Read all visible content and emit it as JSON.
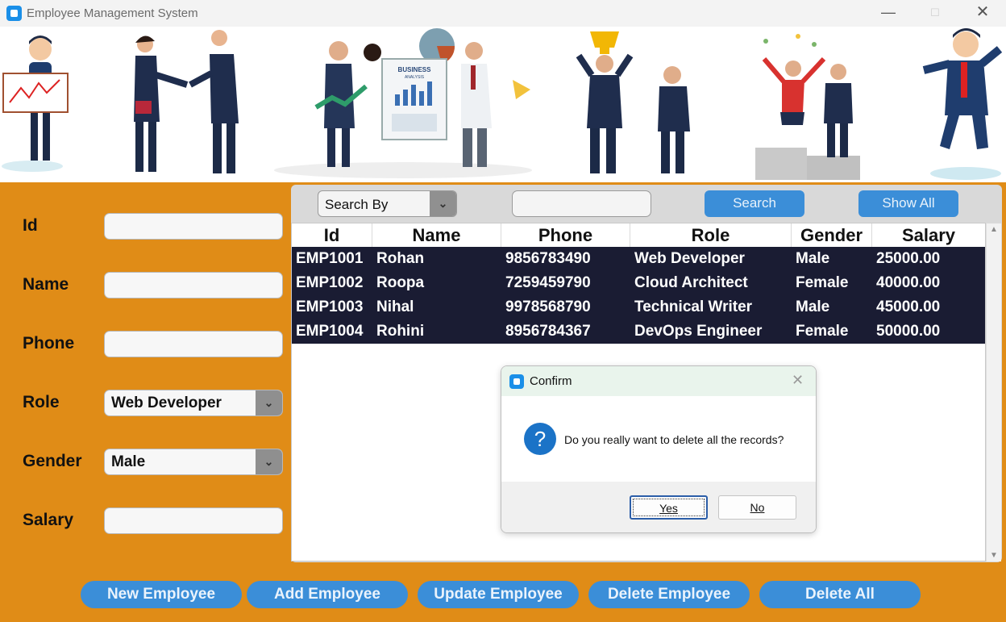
{
  "window": {
    "title": "Employee Management System",
    "controls": {
      "minimize": "—",
      "maximize": "☐",
      "close": "✕"
    }
  },
  "banner": {
    "chart_label_line1": "BUSINESS",
    "chart_label_line2": "ANALYSIS"
  },
  "form": {
    "id_label": "Id",
    "name_label": "Name",
    "phone_label": "Phone",
    "role_label": "Role",
    "role_value": "Web Developer",
    "gender_label": "Gender",
    "gender_value": "Male",
    "salary_label": "Salary"
  },
  "search": {
    "search_by": "Search By",
    "search_button": "Search",
    "show_all_button": "Show All"
  },
  "table": {
    "headers": [
      "Id",
      "Name",
      "Phone",
      "Role",
      "Gender",
      "Salary"
    ],
    "rows": [
      [
        "EMP1001",
        "Rohan",
        "9856783490",
        "Web Developer",
        "Male",
        "25000.00"
      ],
      [
        "EMP1002",
        "Roopa",
        "7259459790",
        "Cloud Architect",
        "Female",
        "40000.00"
      ],
      [
        "EMP1003",
        "Nihal",
        "9978568790",
        "Technical Writer",
        "Male",
        "45000.00"
      ],
      [
        "EMP1004",
        "Rohini",
        "8956784367",
        "DevOps Engineer",
        "Female",
        "50000.00"
      ]
    ]
  },
  "dialog": {
    "title": "Confirm",
    "message": "Do you really want to delete all the records?",
    "yes": "Yes",
    "no": "No",
    "question_glyph": "?",
    "close_glyph": "✕"
  },
  "actions": {
    "new_employee": "New Employee",
    "add_employee": "Add Employee",
    "update_employee": "Update Employee",
    "delete_employee": "Delete Employee",
    "delete_all": "Delete All"
  },
  "colors": {
    "body_orange": "#e08c17",
    "button_blue": "#3b8ed8",
    "table_row_bg": "#1a1c33",
    "dialog_title_bg": "#e9f4ec"
  }
}
